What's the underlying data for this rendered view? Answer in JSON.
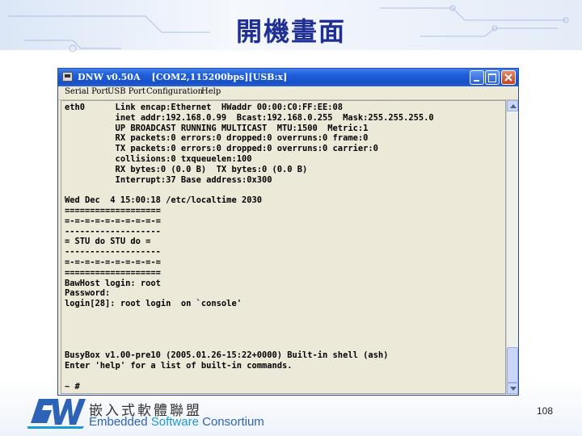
{
  "slide": {
    "title": "開機畫面",
    "page_number": "108"
  },
  "window": {
    "title_app": "DNW v0.50A",
    "title_port": "[COM2,115200bps][USB:x]",
    "menu": [
      "Serial Port",
      "USB Port",
      "Configuration",
      "Help"
    ]
  },
  "terminal": {
    "lines": [
      "eth0      Link encap:Ethernet  HWaddr 00:00:C0:FF:EE:08",
      "          inet addr:192.168.0.99  Bcast:192.168.0.255  Mask:255.255.255.0",
      "          UP BROADCAST RUNNING MULTICAST  MTU:1500  Metric:1",
      "          RX packets:0 errors:0 dropped:0 overruns:0 frame:0",
      "          TX packets:0 errors:0 dropped:0 overruns:0 carrier:0",
      "          collisions:0 txqueuelen:100",
      "          RX bytes:0 (0.0 B)  TX bytes:0 (0.0 B)",
      "          Interrupt:37 Base address:0x300",
      "",
      "Wed Dec  4 15:00:18 /etc/localtime 2030",
      "===================",
      "=-=-=-=-=-=-=-=-=-=",
      "-------------------",
      "= STU do STU do =",
      "-------------------",
      "=-=-=-=-=-=-=-=-=-=",
      "===================",
      "BawHost login: root",
      "Password:",
      "login[28]: root login  on `console'",
      "",
      "",
      "",
      "",
      "BusyBox v1.00-pre10 (2005.01.26-15:22+0000) Built-in shell (ash)",
      "Enter 'help' for a list of built-in commands.",
      "",
      "~ #"
    ]
  },
  "footer": {
    "logo_chinese": "嵌入式軟體聯盟",
    "logo_english_1": "Embedded ",
    "logo_english_2": "Software",
    "logo_english_3": " Consortium"
  },
  "colors": {
    "title_blue": "#1f2f93",
    "titlebar_blue": "#1f5fd9",
    "terminal_bg": "#ece9d8",
    "logo_blue": "#2c63b6"
  }
}
